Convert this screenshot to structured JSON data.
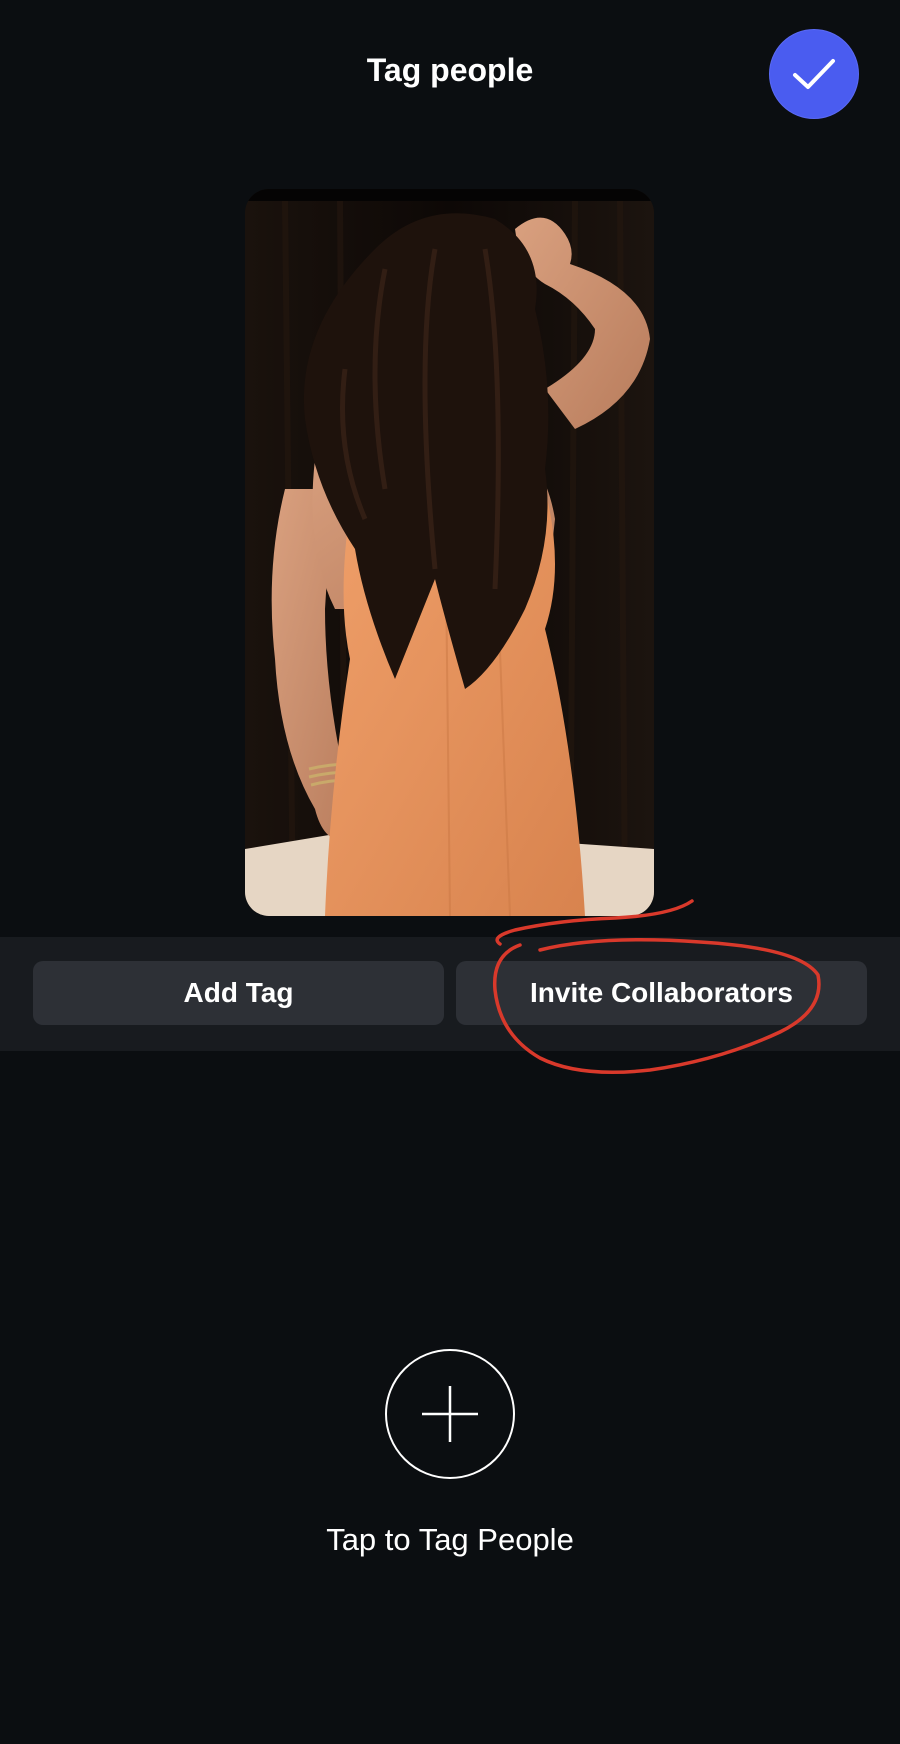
{
  "header": {
    "title": "Tag people",
    "done_icon": "checkmark-icon"
  },
  "photo": {
    "alt": "Photo to tag"
  },
  "actions": {
    "add_tag_label": "Add Tag",
    "invite_collaborators_label": "Invite Collaborators"
  },
  "tag_prompt": {
    "icon": "plus-icon",
    "hint": "Tap to Tag People"
  },
  "colors": {
    "background": "#0b0e11",
    "accent": "#4a5cf0",
    "button_bg": "#2d3036",
    "annotation": "#d9392b"
  }
}
